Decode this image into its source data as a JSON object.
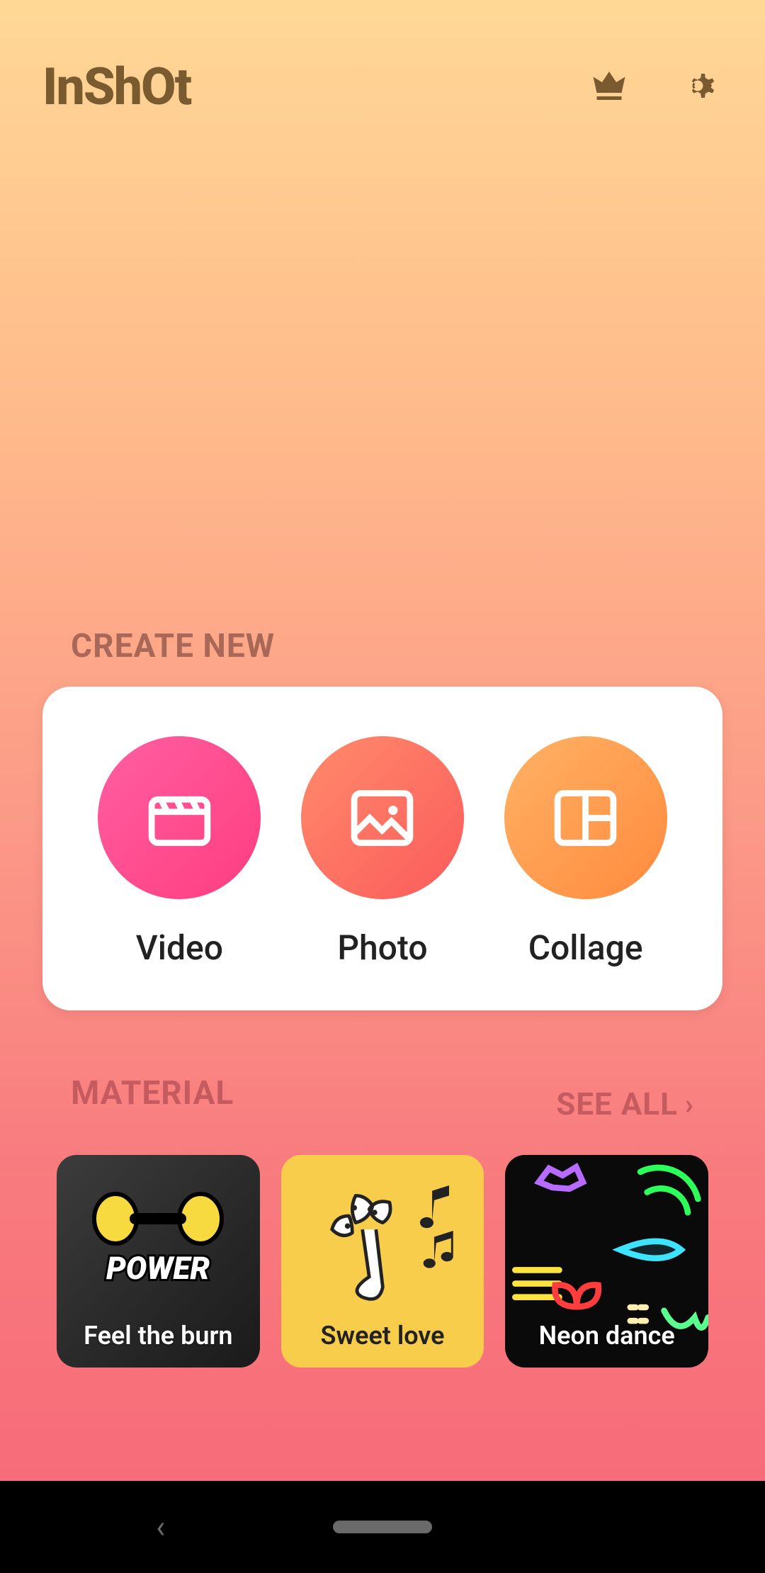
{
  "header": {
    "app_name": "InShOt"
  },
  "create": {
    "section_title": "CREATE NEW",
    "items": [
      {
        "label": "Video",
        "icon": "clapperboard-icon"
      },
      {
        "label": "Photo",
        "icon": "image-icon"
      },
      {
        "label": "Collage",
        "icon": "collage-icon"
      }
    ]
  },
  "material": {
    "section_title": "MATERIAL",
    "see_all_label": "SEE ALL",
    "items": [
      {
        "label": "Feel the burn",
        "theme": "burn"
      },
      {
        "label": "Sweet love",
        "theme": "sweet"
      },
      {
        "label": "Neon dance",
        "theme": "neon"
      }
    ]
  }
}
